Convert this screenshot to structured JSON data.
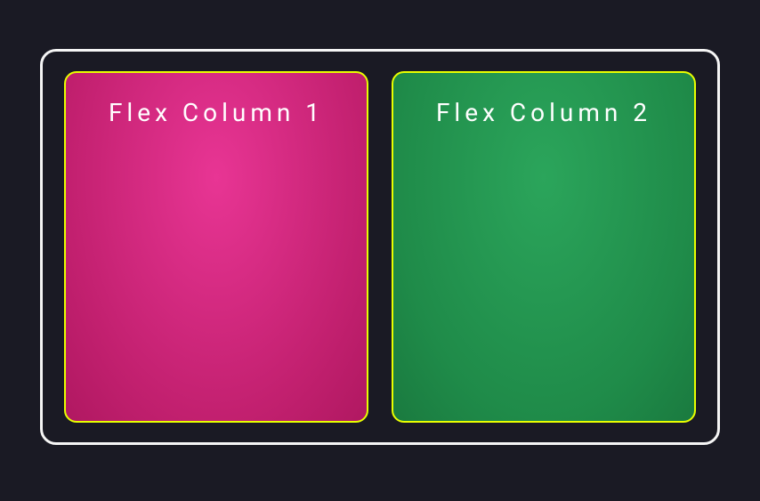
{
  "columns": [
    {
      "label": "Flex Column 1"
    },
    {
      "label": "Flex Column 2"
    }
  ]
}
